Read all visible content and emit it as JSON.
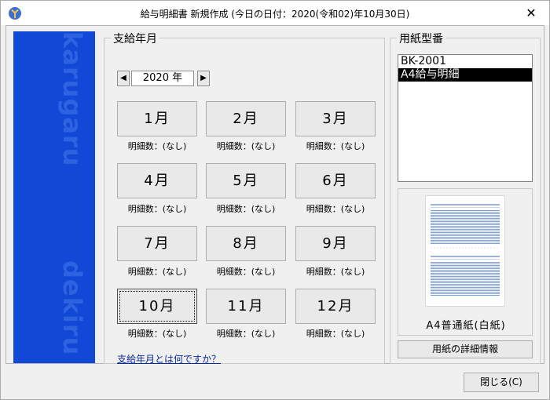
{
  "window": {
    "title": "給与明細書 新規作成 (今日の日付：2020(令和02)年10月30日)",
    "close_glyph": "✕"
  },
  "brand": {
    "top_text": "karugaru",
    "bottom_text": "dekiru"
  },
  "month_group": {
    "label": "支給年月",
    "prev_glyph": "◀",
    "next_glyph": "▶",
    "year_value": "2020 年",
    "months": [
      {
        "label": "1月",
        "count": "明細数：(なし)"
      },
      {
        "label": "2月",
        "count": "明細数：(なし)"
      },
      {
        "label": "3月",
        "count": "明細数：(なし)"
      },
      {
        "label": "4月",
        "count": "明細数：(なし)"
      },
      {
        "label": "5月",
        "count": "明細数：(なし)"
      },
      {
        "label": "6月",
        "count": "明細数：(なし)"
      },
      {
        "label": "7月",
        "count": "明細数：(なし)"
      },
      {
        "label": "8月",
        "count": "明細数：(なし)"
      },
      {
        "label": "9月",
        "count": "明細数：(なし)"
      },
      {
        "label": "10月",
        "count": "明細数：(なし)"
      },
      {
        "label": "11月",
        "count": "明細数：(なし)"
      },
      {
        "label": "12月",
        "count": "明細数：(なし)"
      }
    ],
    "help_link": "支給年月とは何ですか？"
  },
  "paper_group": {
    "label": "用紙型番",
    "items": [
      "BK-2001",
      "A4給与明細"
    ],
    "selected_index": 1,
    "preview_caption": "A4普通紙(白紙)",
    "detail_button": "用紙の詳細情報"
  },
  "footer": {
    "close_button": "閉じる(C)"
  },
  "colors": {
    "brand_panel": "#1149d6",
    "selection": "#000000",
    "link": "#0b2a9e"
  }
}
